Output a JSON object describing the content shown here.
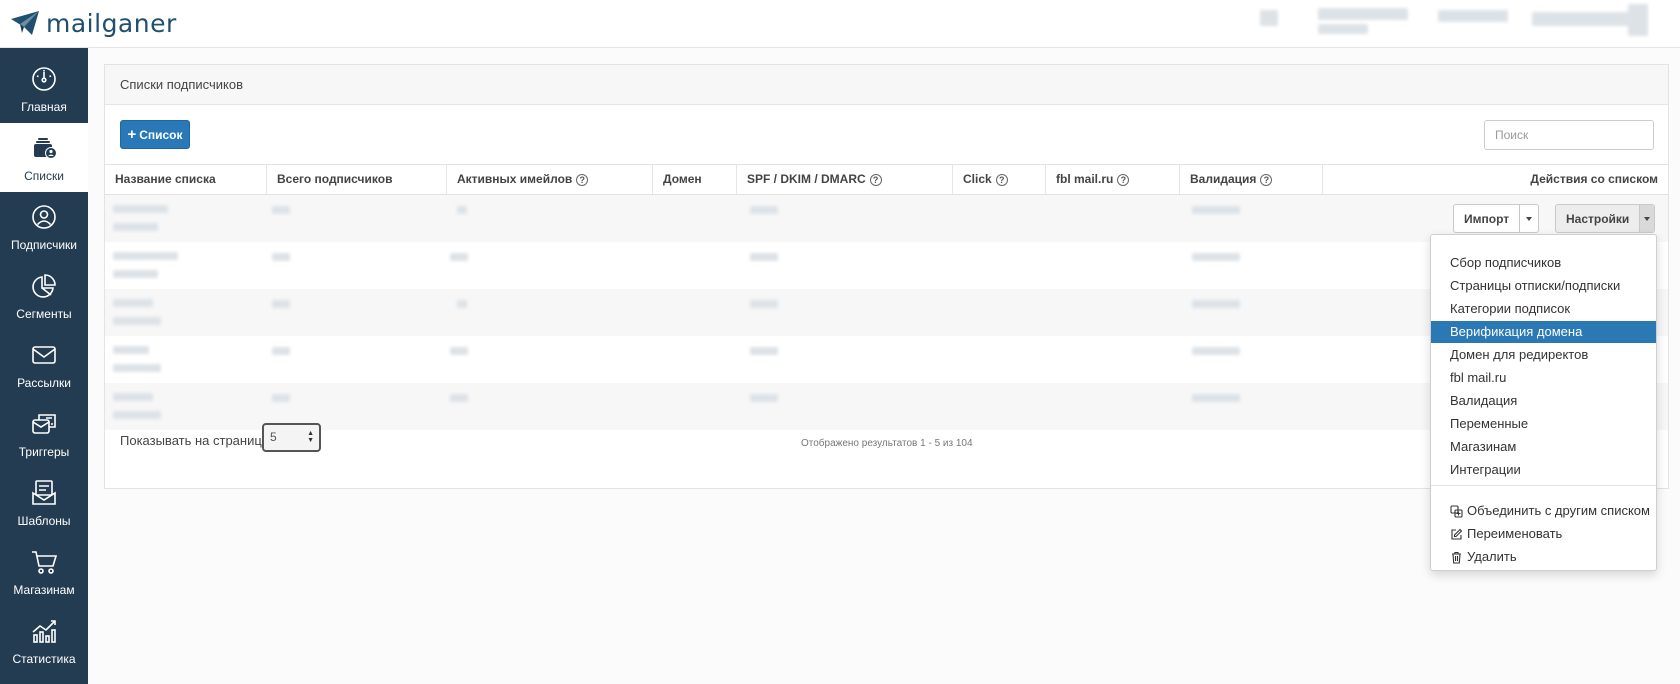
{
  "brand": {
    "name": "mailganer"
  },
  "sidebar": {
    "items": [
      {
        "label": "Главная",
        "icon": "dashboard-icon",
        "active": false
      },
      {
        "label": "Списки",
        "icon": "lists-icon",
        "active": true
      },
      {
        "label": "Подписчики",
        "icon": "subscribers-icon",
        "active": false
      },
      {
        "label": "Сегменты",
        "icon": "segments-icon",
        "active": false
      },
      {
        "label": "Рассылки",
        "icon": "mail-icon",
        "active": false
      },
      {
        "label": "Триггеры",
        "icon": "triggers-icon",
        "active": false
      },
      {
        "label": "Шаблоны",
        "icon": "templates-icon",
        "active": false
      },
      {
        "label": "Магазинам",
        "icon": "cart-icon",
        "active": false
      },
      {
        "label": "Статистика",
        "icon": "stats-icon",
        "active": false
      }
    ]
  },
  "panel": {
    "title": "Списки подписчиков",
    "add_button": "Список",
    "search_placeholder": "Поиск"
  },
  "table": {
    "columns": [
      "Название списка",
      "Всего подписчиков",
      "Активных имейлов",
      "Домен",
      "SPF / DKIM / DMARC",
      "Click",
      "fbl mail.ru",
      "Валидация",
      "Действия со списком"
    ],
    "row_count": 5
  },
  "actions": {
    "import_label": "Импорт",
    "settings_label": "Настройки"
  },
  "footer": {
    "per_page_label": "Показывать на странице",
    "per_page_value": "5",
    "results_text": "Отображено результатов 1 - 5 из 104"
  },
  "dropdown": {
    "items": [
      "Сбор подписчиков",
      "Страницы отписки/подписки",
      "Категории подписок",
      "Верификация домена",
      "Домен для редиректов",
      "fbl mail.ru",
      "Валидация",
      "Переменные",
      "Магазинам",
      "Интеграции"
    ],
    "active_item": "Верификация домена",
    "extra_items": [
      {
        "label": "Объединить с другим списком",
        "icon": "merge-icon"
      },
      {
        "label": "Переименовать",
        "icon": "edit-icon"
      },
      {
        "label": "Удалить",
        "icon": "trash-icon"
      }
    ]
  },
  "colors": {
    "sidebar_bg": "#233c52",
    "primary": "#2979b8",
    "active_menu_bg": "#2a78b4"
  }
}
